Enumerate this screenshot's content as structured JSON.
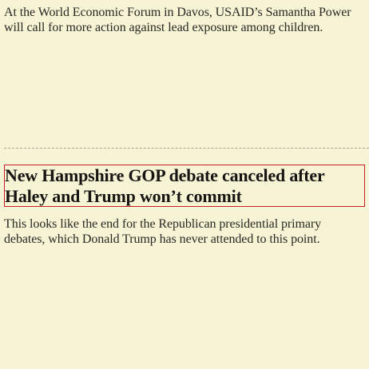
{
  "articles": [
    {
      "summary": "At the World Economic Forum in Davos, USAID’s Samantha Power will call for more action against lead exposure among children."
    },
    {
      "headline": "New Hampshire GOP debate canceled after Haley and Trump won’t commit",
      "summary": "This looks like the end for the Republican presidential primary debates, which Donald Trump has never attended to this point."
    }
  ],
  "colors": {
    "background": "#f7f4d6",
    "focus_outline": "#c81d25",
    "divider": "#a8a493"
  }
}
